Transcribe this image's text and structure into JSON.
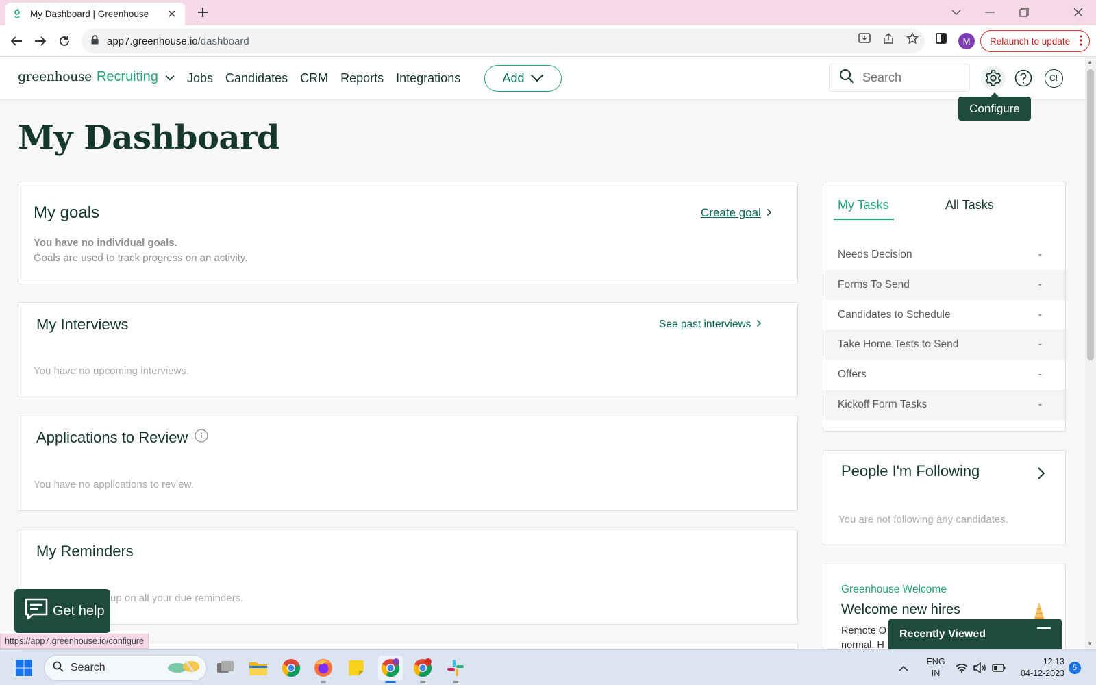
{
  "browser": {
    "tab_title": "My Dashboard | Greenhouse",
    "url_host": "app7.greenhouse.io",
    "url_path": "/dashboard",
    "profile_initial": "M",
    "relaunch_label": "Relaunch to update",
    "status_url": "https://app7.greenhouse.io/configure"
  },
  "header": {
    "brand": "greenhouse",
    "product": "Recruiting",
    "nav": [
      "Jobs",
      "Candidates",
      "CRM",
      "Reports",
      "Integrations"
    ],
    "add_label": "Add",
    "search_placeholder": "Search",
    "user_initials": "CI",
    "tooltip": "Configure"
  },
  "page": {
    "title": "My Dashboard"
  },
  "goals": {
    "title": "My goals",
    "create_link": "Create goal",
    "empty_bold": "You have no individual goals.",
    "empty_sub": "Goals are used to track progress on an activity."
  },
  "interviews": {
    "title": "My Interviews",
    "past_link": "See past interviews",
    "empty": "You have no upcoming interviews."
  },
  "applications": {
    "title": "Applications to Review",
    "empty": "You have no applications to review."
  },
  "reminders": {
    "title": "My Reminders",
    "empty": "up on all your due reminders."
  },
  "tasks": {
    "tab_active": "My Tasks",
    "tab_other": "All Tasks",
    "rows": [
      {
        "label": "Needs Decision",
        "value": "-"
      },
      {
        "label": "Forms To Send",
        "value": "-"
      },
      {
        "label": "Candidates to Schedule",
        "value": "-"
      },
      {
        "label": "Take Home Tests to Send",
        "value": "-"
      },
      {
        "label": "Offers",
        "value": "-"
      },
      {
        "label": "Kickoff Form Tasks",
        "value": "-"
      }
    ]
  },
  "following": {
    "title": "People I'm Following",
    "empty": "You are not following any candidates."
  },
  "welcome": {
    "eyebrow": "Greenhouse Welcome",
    "title": "Welcome new hires",
    "text_1": "Remote O",
    "text_2": "normal. H"
  },
  "widgets": {
    "get_help": "Get help",
    "recently_viewed": "Recently Viewed"
  },
  "taskbar": {
    "search_placeholder": "Search",
    "lang_1": "ENG",
    "lang_2": "IN",
    "time": "12:13",
    "date": "04-12-2023",
    "notification_count": "5"
  },
  "colors": {
    "brand_green": "#24a47f",
    "dark_green": "#15372c",
    "tooltip_bg": "#1f4b3f",
    "tabstrip": "#f6d9e6"
  }
}
